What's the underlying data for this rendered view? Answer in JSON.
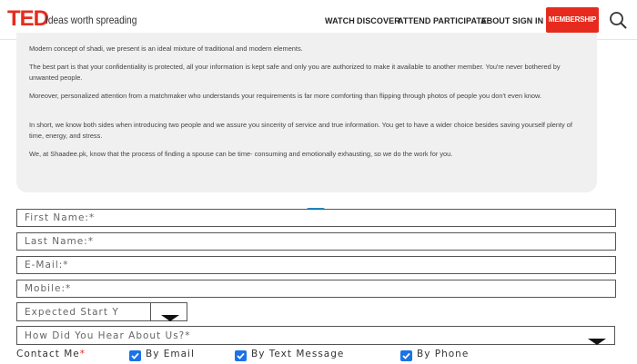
{
  "header": {
    "logo": "TED",
    "tagline": "Ideas worth spreading",
    "nav": [
      "WATCH",
      "DISCOVER",
      "ATTEND",
      "PARTICIPATE",
      "ABOUT",
      "SIGN IN"
    ],
    "membership": "MEMBERSHIP",
    "search_icon": "search-icon",
    "brand_color": "#e62b1e"
  },
  "card": {
    "paragraphs": [
      "Modern concept of shadi, we present is an ideal mixture of traditional and modern elements.",
      "The best part is that your confidentiality is protected, all your information is kept safe and only you are authorized to make it available to another member. You're never bothered by unwanted people.",
      "Moreover, personalized attention from a matchmaker who understands your requirements is far more comforting than flipping through photos of people you don't even know.",
      "In short, we know both sides when introducing two people and we assure you sincerity of service and true information. You get to have a wider choice besides saving yourself plenty of time, energy, and stress.",
      "We, at Shaadee.pk, know that the process of finding a spouse can be time- consuming and emotionally exhausting, so we do the work for you."
    ],
    "divider_icon": "chevron-down-icon",
    "divider_color": "#1b8fd0"
  },
  "form": {
    "first_name": "First Name:*",
    "last_name": "Last Name:*",
    "email": "E-Mail:*",
    "mobile": "Mobile:*",
    "expected_start": "Expected Start Y",
    "hear_about": "How Did You Hear About Us?*",
    "contact_label": "Contact Me",
    "required_mark": "*",
    "contact_options": [
      "By Email",
      "By Text Message",
      "By Phone"
    ],
    "checkbox_color": "#1a73e8"
  }
}
